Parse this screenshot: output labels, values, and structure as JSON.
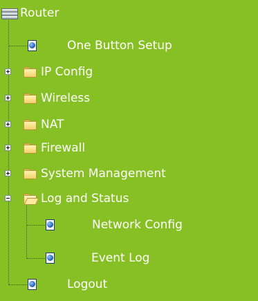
{
  "tree": {
    "root_label": "Router",
    "items": [
      {
        "label": "One Button Setup"
      },
      {
        "label": "IP Config"
      },
      {
        "label": "Wireless"
      },
      {
        "label": "NAT"
      },
      {
        "label": "Firewall"
      },
      {
        "label": "System Management"
      },
      {
        "label": "Log and Status",
        "children": [
          {
            "label": "Network Config"
          },
          {
            "label": "Event Log"
          }
        ]
      },
      {
        "label": "Logout"
      }
    ]
  }
}
